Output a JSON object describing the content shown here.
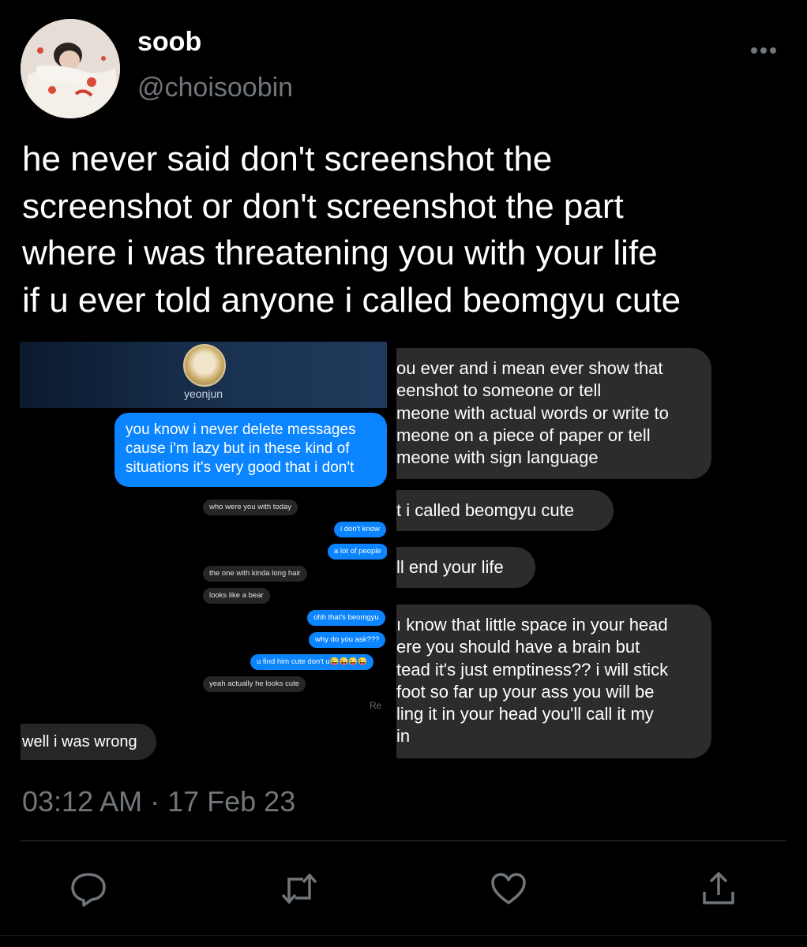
{
  "author": {
    "display_name": "soob",
    "handle": "@choisoobin"
  },
  "menu_icon": "more-horizontal-icon",
  "tweet": {
    "text_lines": [
      "he never said don't screenshot the",
      "screenshot or don't screenshot the part",
      "where i was threatening you with your life",
      "if u ever told anyone i called beomgyu cute"
    ],
    "timestamp": "03:12 AM · 17 Feb 23"
  },
  "left_screenshot": {
    "contact_name": "yeonjun",
    "big_message_lines": [
      "you know i never delete messages",
      "cause i'm lazy but in these kind of",
      "situations it's very good that i don't"
    ],
    "messages": [
      {
        "side": "in",
        "text": "who were you with today"
      },
      {
        "side": "out",
        "text": "i don't know"
      },
      {
        "side": "out",
        "text": "a lot of people"
      },
      {
        "side": "in",
        "text": "the one with kinda long hair"
      },
      {
        "side": "in",
        "text": "looks like a bear"
      },
      {
        "side": "out",
        "text": "ohh that's beomgyu"
      },
      {
        "side": "out",
        "text": "why do you ask???"
      },
      {
        "side": "out",
        "text": "u find him cute don't u😜😜😜😜"
      },
      {
        "side": "in",
        "text": "yeah actually he looks cute"
      }
    ],
    "receipt": "Re",
    "bottom_message": "well i was wrong"
  },
  "right_screenshot": {
    "bubble1_lines": [
      "ou ever and i mean ever show that",
      "eenshot to someone or tell",
      "meone with actual words or write to",
      "meone on a piece of paper or tell",
      "meone with sign language"
    ],
    "bubble2": "t i called beomgyu cute",
    "bubble3": "ll end your life",
    "bubble4_lines": [
      "ı know that little space in your head",
      "ere you should have a brain but",
      "tead it's just emptiness?? i will stick",
      " foot so far up your ass you will be",
      "ling it in your head you'll call it my",
      "in"
    ]
  },
  "actions": {
    "icons": [
      "reply-icon",
      "retweet-icon",
      "like-icon",
      "share-icon"
    ]
  },
  "colors": {
    "background": "#000000",
    "secondary_text": "#71767b",
    "imessage_blue": "#0a84ff",
    "gray_bubble": "#2c2c2e"
  }
}
